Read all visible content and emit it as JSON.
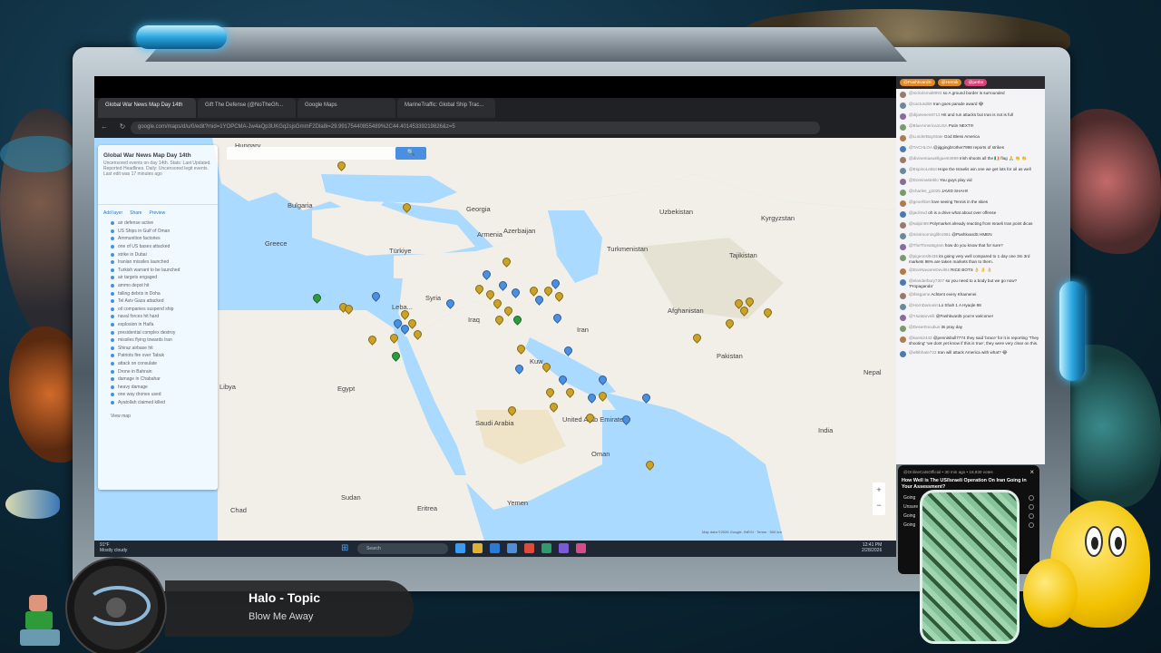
{
  "browser": {
    "tabs": [
      {
        "label": "Global War News Map Day 14th",
        "active": true
      },
      {
        "label": "Gift The Defense (@NoTheGh...",
        "active": false
      },
      {
        "label": "Google Maps",
        "active": false
      },
      {
        "label": "MarineTraffic: Global Ship Trac...",
        "active": false
      }
    ],
    "url": "google.com/maps/d/u/0/edit?mid=1YOPCMA-Jw4aQp3UKGq2sjsGmmF2Dla8i=29.99175440855489%2C44.40145339219826&z=5"
  },
  "map": {
    "sidebar": {
      "title": "Global War News Map Day 14th",
      "description": "Uncensored events on day 14th. Stats: Last Updated. Reported Headlines. Daily: Uncensored legit events.",
      "last_edit": "Last edit was 17 minutes ago",
      "actions": [
        "Add layer",
        "Share",
        "Preview"
      ],
      "layers": [
        "air defense active",
        "US Ships in Gulf of Oman",
        "Ammunition factories",
        "one of US bases attacked",
        "strike in Dubai",
        "Iranian missiles launched",
        "Turkish warrant to be launched",
        "air targets engaged",
        "ammo depot hit",
        "falling debris in Doha",
        "Tel Aviv Gaza attacked",
        "oil companies suspend ship",
        "naval forces hit hard",
        "explosion in Haifa",
        "presidential complex destroy",
        "missiles flying towards Iran",
        "Shiraz airbase hit",
        "Patriots fire over Tabuk",
        "attack on consulate",
        "Drone in Bahrain",
        "damage in Chabahar",
        "heavy damage",
        "one way drones used",
        "Ayatollah claimed killed"
      ],
      "more": "View map"
    },
    "search_button": "🔍",
    "labels": {
      "Hungary": "Hungary",
      "Bulgaria": "Bulgaria",
      "Georgia": "Georgia",
      "Armenia": "Armenia",
      "Azerbaijan": "Azerbaijan",
      "Uzbekistan": "Uzbekistan",
      "Kyrgyzstan": "Kyrgyzstan",
      "Turkmenistan": "Turkmenistan",
      "Tajikistan": "Tajikistan",
      "Greece": "Greece",
      "Turkiye": "Türkiye",
      "Syria": "Syria",
      "Lebanon": "Leba...",
      "Iraq": "Iraq",
      "Iran": "Iran",
      "Afghanistan": "Afghanistan",
      "Pakistan": "Pakistan",
      "Nepal": "Nepal",
      "Libya": "Libya",
      "Egypt": "Egypt",
      "Kuwait": "Kuw",
      "UAE": "United Arab Emirates",
      "SaudiArabia": "Saudi Arabia",
      "Oman": "Oman",
      "India": "India",
      "Sudan": "Sudan",
      "Eritrea": "Eritrea",
      "Yemen": "Yemen",
      "Chad": "Chad"
    },
    "footer": "Map data ©2026 Google, INEGI · Terms · 500 km"
  },
  "taskbar": {
    "weather_temp": "91°F",
    "weather_desc": "Mostly cloudy",
    "search_placeholder": "Search",
    "time": "12:41 PM",
    "date": "2/28/2026"
  },
  "chat": {
    "pills": [
      {
        "label": "@PashkvardS",
        "color": "#e08a2a"
      },
      {
        "label": "@Hernik",
        "color": "#e08a2a"
      },
      {
        "label": "@petbo",
        "color": "#d8437a"
      }
    ],
    "messages": [
      {
        "name": "@nickolsmal8993",
        "text": "so A ground border is surrounded"
      },
      {
        "name": "@cactusd69",
        "text": "Iran goes parade award 😂"
      },
      {
        "name": "@dijanesen8713",
        "text": "Hit and run attacks but Iran is not is full"
      },
      {
        "name": "@BlueAmerica1USA",
        "text": "Putin NEXT!!!"
      },
      {
        "name": "@LunderBayState",
        "text": "God Bless America"
      },
      {
        "name": "@TACHLOA",
        "text": "@jiggingbrother7998 reports of strikes"
      },
      {
        "name": "@divinemaxwellguest4999",
        "text": "Irish shoots all the 🇮🇪 flag 🙏 👏 👏"
      },
      {
        "name": "@EspinoLeBot",
        "text": "Hope the Israelis win one we get lots for oil as well"
      },
      {
        "name": "@Dominasteblo",
        "text": "You guys play vid"
      },
      {
        "name": "@charles_g1025",
        "text": "JAVID SHAH!!"
      },
      {
        "name": "@geoehbet",
        "text": "love seeing Tennis in the skies"
      },
      {
        "name": "@jaclinvd",
        "text": "oh is a drive what about over offense"
      },
      {
        "name": "@salpin98",
        "text": "Polymarket already reacting from Israeli Iran point dicas"
      },
      {
        "name": "@mintmorninglife1991",
        "text": "@PashkvardS HMEN"
      },
      {
        "name": "@TheThreatsgram",
        "text": "how do you know that for sure?"
      },
      {
        "name": "@pigeonsl9436",
        "text": "its going very well compared to 1 day one 3m 3rd markets 98% are taken markets than to them."
      },
      {
        "name": "@DonNavarreDevil04",
        "text": "RICE BOTS 👌 👌 👌"
      },
      {
        "name": "@elanderbury7307",
        "text": "so you need to a body but we go now? 'Propaganda'"
      },
      {
        "name": "@thisgame",
        "text": "Achtent every Khamenei"
      },
      {
        "name": "@HornDamanit",
        "text": "Lo Shah 1 A Hyaqle 98"
      },
      {
        "name": "@YsaMarvelli",
        "text": "@Pashkvard5 you're welcome!"
      },
      {
        "name": "@DesertIncubus",
        "text": "its pray day"
      },
      {
        "name": "@kansi2443",
        "text": "@pennisbull7774 they said 'brace' for it is reporting 'They shooting' 'we dont yet know if this is true', they were very clear on this."
      },
      {
        "name": "@wltibhate723",
        "text": "Iran will attack America with what? 😂"
      }
    ]
  },
  "poll": {
    "author": "@OnlineCatsOfficial • 30 min ago • 18,930 votes",
    "question": "How Well is The US/Israeli Operation On Iran Going in Your Assessment?",
    "options": [
      "Going",
      "Unsure",
      "Going",
      "Going"
    ]
  },
  "now_playing": {
    "title": "Halo - Topic",
    "subtitle": "Blow Me Away"
  },
  "colors": {
    "map_water": "#aadaff",
    "land": "#f1efe8",
    "marker_gold": "#c9a227",
    "marker_blue": "#4a8fe0",
    "marker_green": "#2e9a3e",
    "chat_pill_orange": "#e08a2a",
    "chat_pill_pink": "#d8437a"
  }
}
